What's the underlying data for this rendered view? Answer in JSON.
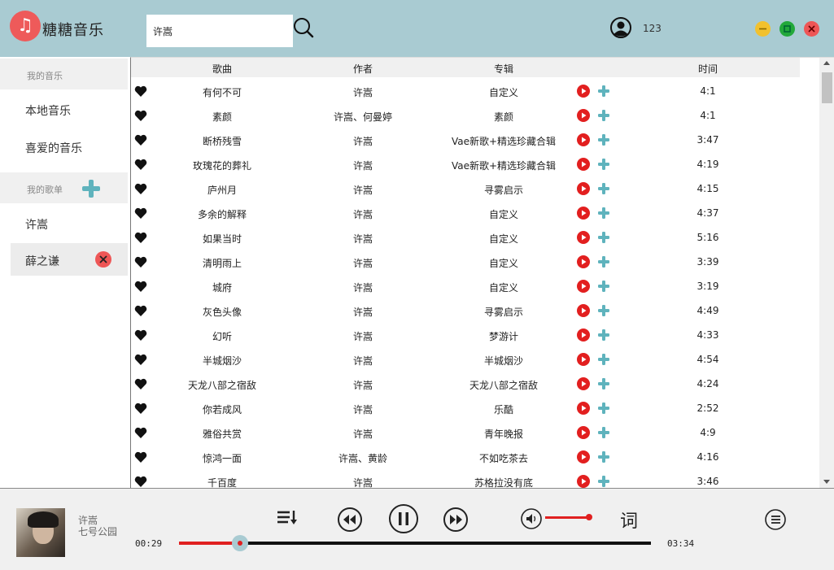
{
  "app": {
    "title": "糖糖音乐",
    "logo_glyph": "♫"
  },
  "search": {
    "value": "许嵩"
  },
  "user": {
    "name": "123"
  },
  "sidebar": {
    "my_music_label": "我的音乐",
    "local_music": "本地音乐",
    "favorite_music": "喜爱的音乐",
    "my_playlists_label": "我的歌单",
    "playlists": [
      "许嵩",
      "薛之谦"
    ]
  },
  "table": {
    "headers": {
      "song": "歌曲",
      "artist": "作者",
      "album": "专辑",
      "time": "时间"
    },
    "rows": [
      {
        "song": "有何不可",
        "artist": "许嵩",
        "album": "自定义",
        "time": "4:1"
      },
      {
        "song": "素颜",
        "artist": "许嵩、何曼婷",
        "album": "素颜",
        "time": "4:1"
      },
      {
        "song": "断桥残雪",
        "artist": "许嵩",
        "album": "Vae新歌+精选珍藏合辑",
        "time": "3:47"
      },
      {
        "song": "玫瑰花的葬礼",
        "artist": "许嵩",
        "album": "Vae新歌+精选珍藏合辑",
        "time": "4:19"
      },
      {
        "song": "庐州月",
        "artist": "许嵩",
        "album": "寻雾启示",
        "time": "4:15"
      },
      {
        "song": "多余的解释",
        "artist": "许嵩",
        "album": "自定义",
        "time": "4:37"
      },
      {
        "song": "如果当时",
        "artist": "许嵩",
        "album": "自定义",
        "time": "5:16"
      },
      {
        "song": "清明雨上",
        "artist": "许嵩",
        "album": "自定义",
        "time": "3:39"
      },
      {
        "song": "城府",
        "artist": "许嵩",
        "album": "自定义",
        "time": "3:19"
      },
      {
        "song": "灰色头像",
        "artist": "许嵩",
        "album": "寻雾启示",
        "time": "4:49"
      },
      {
        "song": "幻听",
        "artist": "许嵩",
        "album": "梦游计",
        "time": "4:33"
      },
      {
        "song": "半城烟沙",
        "artist": "许嵩",
        "album": "半城烟沙",
        "time": "4:54"
      },
      {
        "song": "天龙八部之宿敌",
        "artist": "许嵩",
        "album": "天龙八部之宿敌",
        "time": "4:24"
      },
      {
        "song": "你若成风",
        "artist": "许嵩",
        "album": "乐酷",
        "time": "2:52"
      },
      {
        "song": "雅俗共赏",
        "artist": "许嵩",
        "album": "青年晚报",
        "time": "4:9"
      },
      {
        "song": "惊鸿一面",
        "artist": "许嵩、黄龄",
        "album": "不如吃茶去",
        "time": "4:16"
      },
      {
        "song": "千百度",
        "artist": "许嵩",
        "album": "苏格拉没有底",
        "time": "3:46"
      }
    ]
  },
  "player": {
    "artist": "许嵩",
    "album": "七号公园",
    "elapsed": "00:29",
    "duration": "03:34",
    "progress": 0.13,
    "lyrics_label": "词"
  },
  "colors": {
    "header_bg": "#a9cbd2",
    "accent_red": "#e02020",
    "plus_teal": "#5fb3bd"
  }
}
